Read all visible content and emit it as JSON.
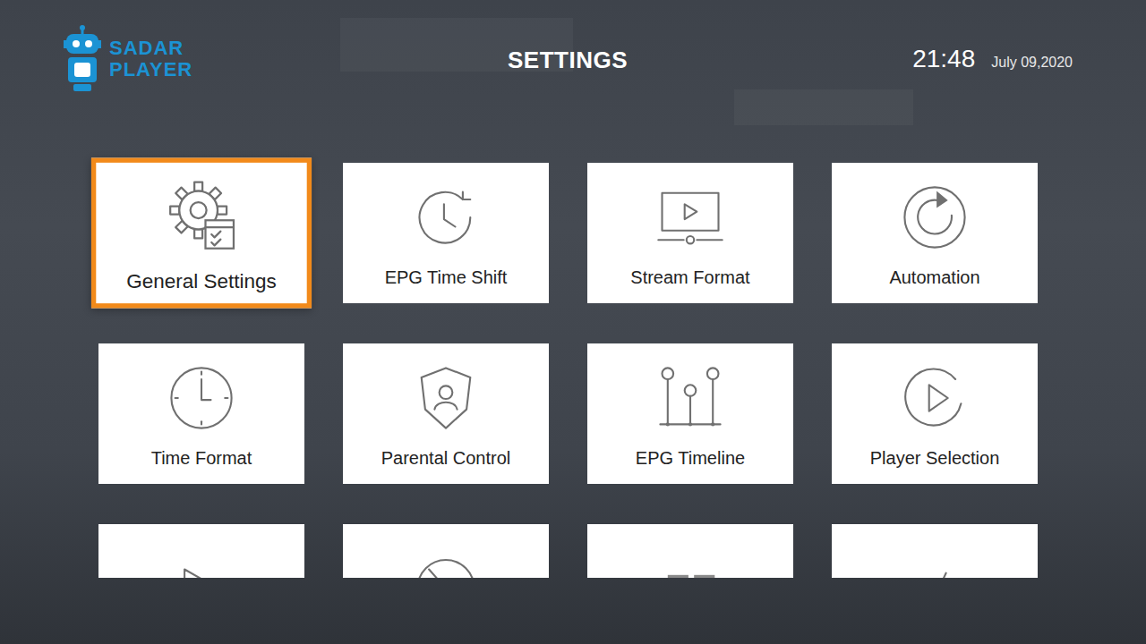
{
  "logo": {
    "lines": [
      "SADAR",
      "PLAYER"
    ]
  },
  "header": {
    "title": "SETTINGS",
    "time": "21:48",
    "date": "July 09,2020"
  },
  "cards": [
    {
      "label": "General Settings",
      "selected": true
    },
    {
      "label": "EPG Time Shift",
      "selected": false
    },
    {
      "label": "Stream Format",
      "selected": false
    },
    {
      "label": "Automation",
      "selected": false
    },
    {
      "label": "Time Format",
      "selected": false
    },
    {
      "label": "Parental Control",
      "selected": false
    },
    {
      "label": "EPG Timeline",
      "selected": false
    },
    {
      "label": "Player Selection",
      "selected": false
    },
    {
      "selected": false
    },
    {
      "selected": false
    },
    {
      "selected": false
    },
    {
      "selected": false
    }
  ]
}
